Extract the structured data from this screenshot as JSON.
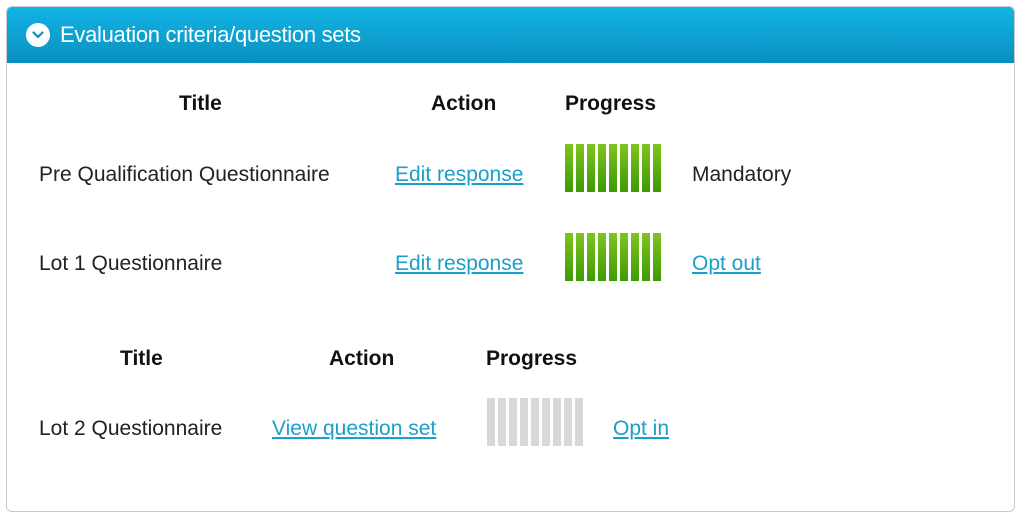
{
  "panel": {
    "title": "Evaluation criteria/question sets"
  },
  "table1": {
    "headers": {
      "title": "Title",
      "action": "Action",
      "progress": "Progress"
    },
    "rows": [
      {
        "title": "Pre Qualification Questionnaire",
        "action": "Edit response",
        "progress_fraction": 1.0,
        "status": "Mandatory"
      },
      {
        "title": "Lot 1 Questionnaire",
        "action": "Edit response",
        "progress_fraction": 1.0,
        "status": "Opt out"
      }
    ]
  },
  "table2": {
    "headers": {
      "title": "Title",
      "action": "Action",
      "progress": "Progress"
    },
    "rows": [
      {
        "title": "Lot 2 Questionnaire",
        "action": "View question set",
        "progress_fraction": 0.0,
        "status": "Opt in"
      }
    ]
  },
  "colors": {
    "header_bg": "#0a9fd3",
    "link": "#199fc9",
    "progress_filled": "#5aaf12",
    "progress_empty": "#d8d8d8"
  },
  "icons": {
    "collapse": "chevron-down-icon"
  }
}
